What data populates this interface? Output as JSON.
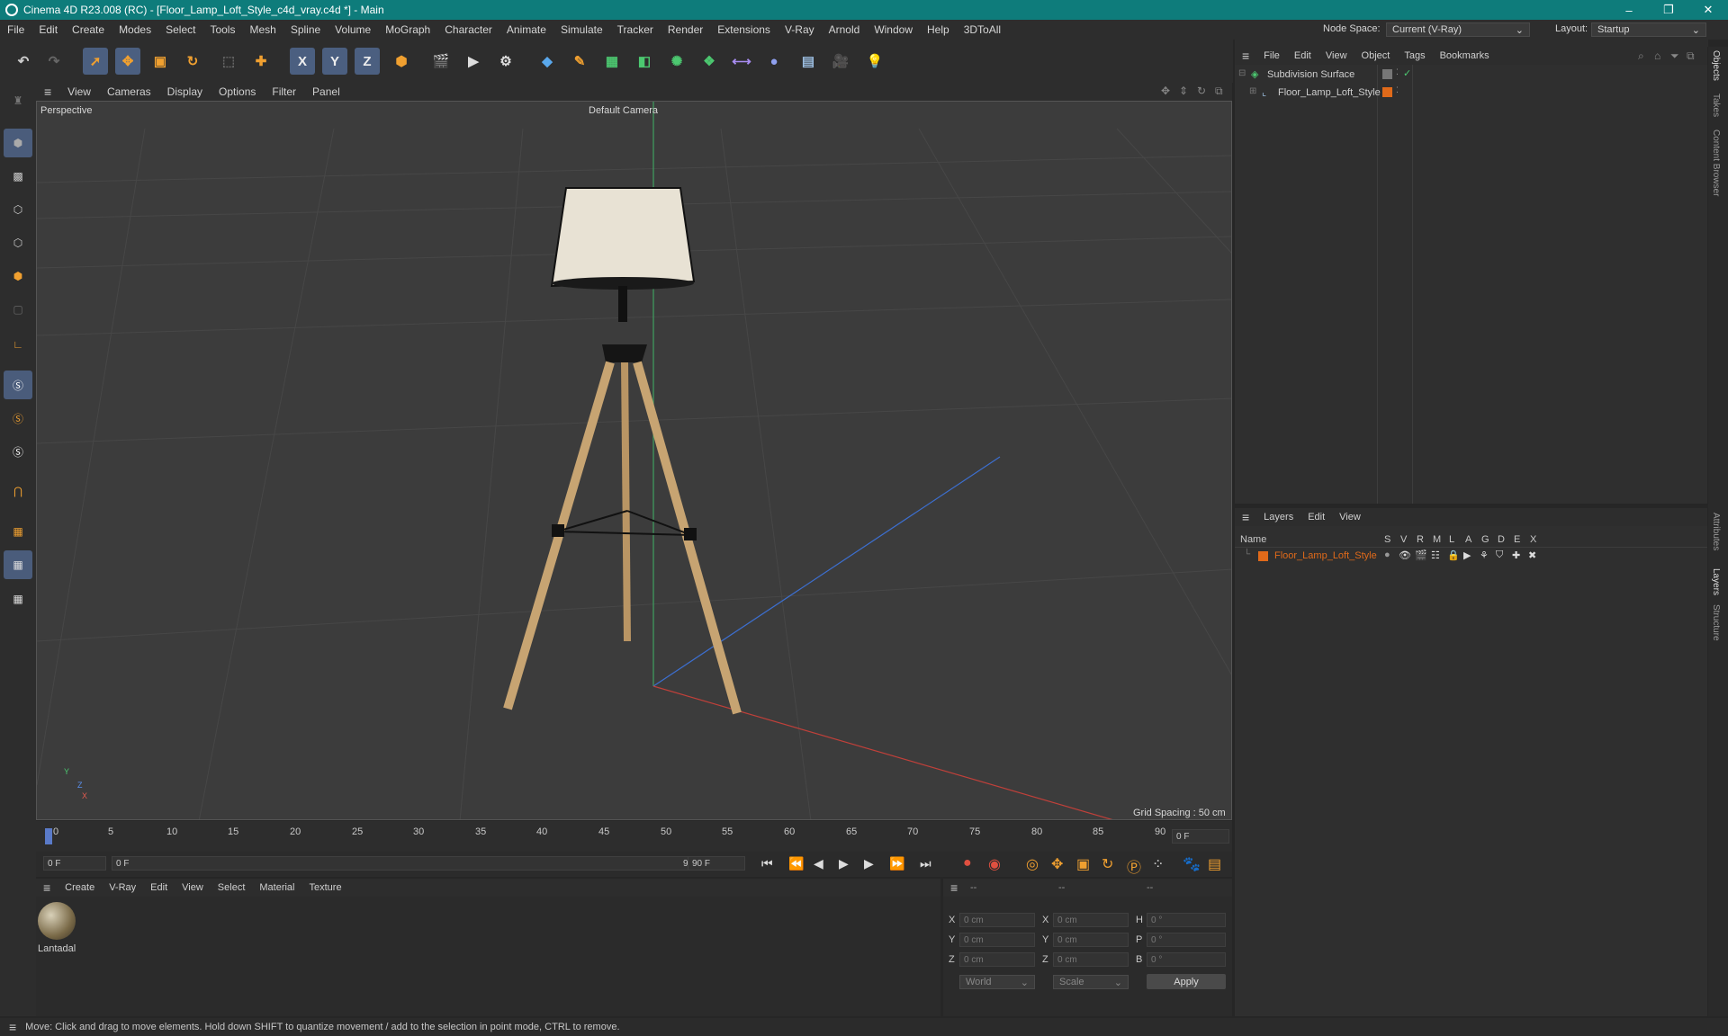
{
  "window": {
    "title": "Cinema 4D R23.008 (RC) - [Floor_Lamp_Loft_Style_c4d_vray.c4d *] - Main",
    "minimize": "–",
    "restore": "❐",
    "close": "✕"
  },
  "menu": {
    "items": [
      "File",
      "Edit",
      "Create",
      "Modes",
      "Select",
      "Tools",
      "Mesh",
      "Spline",
      "Volume",
      "MoGraph",
      "Character",
      "Animate",
      "Simulate",
      "Tracker",
      "Render",
      "Extensions",
      "V-Ray",
      "Arnold",
      "Window",
      "Help",
      "3DToAll"
    ],
    "node_space_label": "Node Space:",
    "node_space_value": "Current (V-Ray)",
    "layout_label": "Layout:",
    "layout_value": "Startup"
  },
  "toolbar": {
    "axis_x": "X",
    "axis_y": "Y",
    "axis_z": "Z"
  },
  "viewport": {
    "menu": [
      "View",
      "Cameras",
      "Display",
      "Options",
      "Filter",
      "Panel"
    ],
    "view_name": "Perspective",
    "camera": "Default Camera",
    "grid_spacing": "Grid Spacing : 50 cm",
    "axis_y": "Y",
    "axis_z": "Z",
    "axis_x": "X"
  },
  "timeline": {
    "ticks": [
      "0",
      "5",
      "10",
      "15",
      "20",
      "25",
      "30",
      "35",
      "40",
      "45",
      "50",
      "55",
      "60",
      "65",
      "70",
      "75",
      "80",
      "85",
      "90"
    ],
    "current_frame": "0 F"
  },
  "transport": {
    "start_field": "0 F",
    "range_start": "0 F",
    "range_end": "90 F",
    "end_field": "90 F"
  },
  "material_panel": {
    "menu": [
      "Create",
      "V-Ray",
      "Edit",
      "View",
      "Select",
      "Material",
      "Texture"
    ],
    "materials": [
      {
        "name": "Lantadal"
      }
    ]
  },
  "coord_panel": {
    "headers": [
      "--",
      "--",
      "--"
    ],
    "rows": [
      {
        "l1": "X",
        "v1": "0 cm",
        "l2": "X",
        "v2": "0 cm",
        "l3": "H",
        "v3": "0 °"
      },
      {
        "l1": "Y",
        "v1": "0 cm",
        "l2": "Y",
        "v2": "0 cm",
        "l3": "P",
        "v3": "0 °"
      },
      {
        "l1": "Z",
        "v1": "0 cm",
        "l2": "Z",
        "v2": "0 cm",
        "l3": "B",
        "v3": "0 °"
      }
    ],
    "world": "World",
    "scale": "Scale",
    "apply": "Apply"
  },
  "object_panel": {
    "menu": [
      "File",
      "Edit",
      "View",
      "Object",
      "Tags",
      "Bookmarks"
    ],
    "objects": [
      {
        "name": "Subdivision Surface"
      },
      {
        "name": "Floor_Lamp_Loft_Style"
      }
    ]
  },
  "layer_panel": {
    "menu": [
      "Layers",
      "Edit",
      "View"
    ],
    "col_name": "Name",
    "cols": [
      "S",
      "V",
      "R",
      "M",
      "L",
      "A",
      "G",
      "D",
      "E",
      "X"
    ],
    "layers": [
      {
        "name": "Floor_Lamp_Loft_Style",
        "color": "#e06a1a"
      }
    ]
  },
  "side_tabs": [
    "Objects",
    "Takes",
    "Content Browser",
    "Attributes",
    "Layers",
    "Structure"
  ],
  "status": "Move: Click and drag to move elements. Hold down SHIFT to quantize movement / add to the selection in point mode, CTRL to remove.",
  "colors": {
    "titlebar": "#0e7c7b",
    "accent_orange": "#e06a1a",
    "selection_blue": "#4b5f80"
  }
}
